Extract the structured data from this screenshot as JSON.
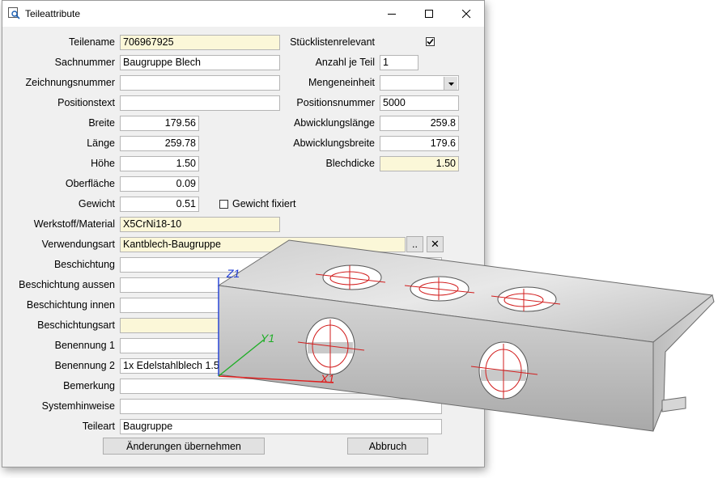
{
  "window": {
    "title": "Teileattribute",
    "icon": "search-part-icon"
  },
  "left": [
    {
      "label": "Teilename",
      "value": "706967925",
      "style": "yellow",
      "w": 198
    },
    {
      "label": "Sachnummer",
      "value": "Baugruppe Blech",
      "style": "white",
      "w": 198
    },
    {
      "label": "Zeichnungsnummer",
      "value": "",
      "style": "white",
      "w": 198
    },
    {
      "label": "Positionstext",
      "value": "",
      "style": "white",
      "w": 198
    },
    {
      "label": "Breite",
      "value": "179.56",
      "style": "num",
      "w": 98
    },
    {
      "label": "Länge",
      "value": "259.78",
      "style": "num",
      "w": 98
    },
    {
      "label": "Höhe",
      "value": "1.50",
      "style": "num",
      "w": 98
    },
    {
      "label": "Oberfläche",
      "value": "0.09",
      "style": "num",
      "w": 98
    },
    {
      "label": "Gewicht",
      "value": "0.51",
      "style": "num",
      "w": 98
    },
    {
      "label": "Werkstoff/Material",
      "value": "X5CrNi18-10",
      "style": "yellow",
      "w": 198
    },
    {
      "label": "Verwendungsart",
      "value": "Kantblech-Baugruppe",
      "style": "yellow",
      "w": 353
    },
    {
      "label": "Beschichtung",
      "value": "",
      "style": "white",
      "w": 398
    },
    {
      "label": "Beschichtung aussen",
      "value": "",
      "style": "white",
      "w": 398
    },
    {
      "label": "Beschichtung innen",
      "value": "",
      "style": "white",
      "w": 398
    },
    {
      "label": "Beschichtungsart",
      "value": "",
      "style": "yellow",
      "w": 398
    },
    {
      "label": "Benennung 1",
      "value": "",
      "style": "white",
      "w": 398
    },
    {
      "label": "Benennung 2",
      "value": "1x Edelstahlblech 1.5",
      "style": "white",
      "w": 398
    },
    {
      "label": "Bemerkung",
      "value": "",
      "style": "white",
      "w": 398
    },
    {
      "label": "Systemhinweise",
      "value": "",
      "style": "white",
      "w": 398
    },
    {
      "label": "Teileart",
      "value": "Baugruppe",
      "style": "white",
      "w": 398
    }
  ],
  "right": [
    {
      "label": "Stücklistenrelevant",
      "type": "checkbox",
      "checked": true
    },
    {
      "label": "Anzahl je Teil",
      "value": "1",
      "style": "white",
      "w": 48
    },
    {
      "label": "Mengeneinheit",
      "value": "",
      "style": "dropdown",
      "w": 98
    },
    {
      "label": "Positionsnummer",
      "value": "5000",
      "style": "white",
      "w": 98
    },
    {
      "label": "Abwicklungslänge",
      "value": "259.8",
      "style": "num",
      "w": 98
    },
    {
      "label": "Abwicklungsbreite",
      "value": "179.6",
      "style": "num",
      "w": 98
    },
    {
      "label": "Blechdicke",
      "value": "1.50",
      "style": "numyellow",
      "w": 98
    }
  ],
  "gewicht_fixiert": {
    "label": "Gewicht fixiert",
    "checked": false
  },
  "verwendungsart_buttons": {
    "browse": "..",
    "clear": "✕"
  },
  "buttons": {
    "apply": "Änderungen übernehmen",
    "cancel": "Abbruch"
  },
  "axes": {
    "x": "X1",
    "y": "Y1",
    "z": "Z1"
  }
}
